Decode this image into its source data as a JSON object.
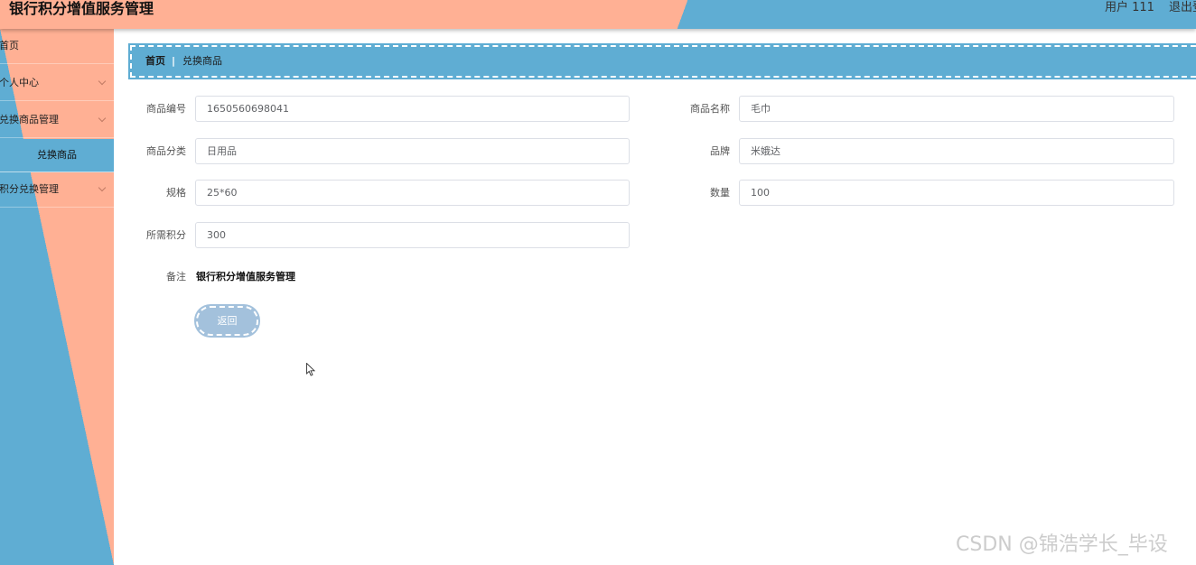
{
  "header": {
    "title": "银行积分增值服务管理",
    "user": "用户 111",
    "logout": "退出登录"
  },
  "sidebar": {
    "items": [
      {
        "label": "首页"
      },
      {
        "label": "个人中心"
      },
      {
        "label": "兑换商品管理"
      },
      {
        "label": "兑换商品"
      },
      {
        "label": "积分兑换管理"
      }
    ]
  },
  "breadcrumb": {
    "home": "首页",
    "separator": "|",
    "current": "兑换商品"
  },
  "form": {
    "product_no": {
      "label": "商品编号",
      "value": "1650560698041"
    },
    "product_name": {
      "label": "商品名称",
      "value": "毛巾"
    },
    "category": {
      "label": "商品分类",
      "value": "日用品"
    },
    "brand": {
      "label": "品牌",
      "value": "米娥达"
    },
    "spec": {
      "label": "规格",
      "value": "25*60"
    },
    "quantity": {
      "label": "数量",
      "value": "100"
    },
    "points": {
      "label": "所需积分",
      "value": "300"
    },
    "remark": {
      "label": "备注",
      "value": "银行积分增值服务管理"
    },
    "back_label": "返回"
  },
  "watermark": "CSDN @锦浩学长_毕设",
  "colors": {
    "peach": "#ffb094",
    "blue": "#5fadd3",
    "button": "#a3c1dc"
  }
}
